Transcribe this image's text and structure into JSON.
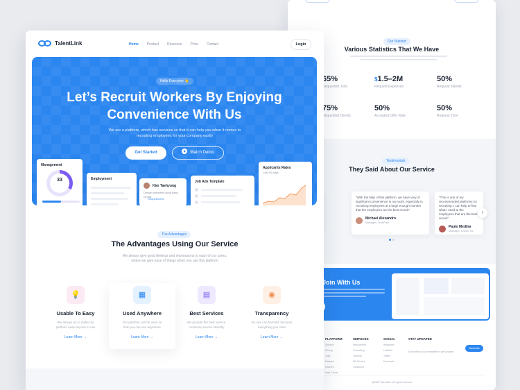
{
  "back": {
    "stats_pill": "Our Statistic",
    "stats_title": "Various Statistics That We Have",
    "stats": [
      {
        "prefix": "",
        "value": "65%",
        "label": "Requested Jobs"
      },
      {
        "prefix": "$",
        "value": "1.5–2M",
        "label": "Request Expenses"
      },
      {
        "prefix": "",
        "value": "50%",
        "label": "Request Talents"
      },
      {
        "prefix": "",
        "value": "75%",
        "label": "Requested Clients"
      },
      {
        "prefix": "",
        "value": "50%",
        "label": "Accepted Offer Rate"
      },
      {
        "prefix": "",
        "value": "50%",
        "label": "Request Time"
      }
    ],
    "testi_pill": "Testimonials",
    "testi_title": "They Said About Our Service",
    "testimonial_main": {
      "quote": "\"With the help of this platform, we have very of significant convenience in our work, especially in recruiting employees at a large enough number that the employees we the best recruit\"",
      "name": "Michael Alexandro",
      "role": "Manager, TechPark"
    },
    "testimonial_right": {
      "quote": "\"This is one of my recommended platforms for recruiting. I can help to find what I need to the employees that are the best recruit\"",
      "name": "Paulo Medina",
      "role": "Manager, Crown Inc"
    },
    "join_title": "Join With Us",
    "footer": [
      {
        "heading": "PLATFORM",
        "items": [
          "Solution",
          "Pricing",
          "Jobs",
          "Partners",
          "Careers",
          "Help Center"
        ]
      },
      {
        "heading": "SERVICES",
        "items": [
          "Recruitment",
          "Consulting",
          "Training",
          "HR Service",
          "Outsource"
        ]
      },
      {
        "heading": "SOCIAL",
        "items": [
          "Instagram",
          "LinkedIn",
          "Twitter",
          "Facebook"
        ]
      },
      {
        "heading": "STAY UPDATED",
        "items": [
          "Subscribe to our newsletter to get updates"
        ]
      }
    ],
    "subscribe_label": "Subscribe",
    "copyright": "@2023 TalentLink. All rights reserved"
  },
  "nav": {
    "brand": "TalentLink",
    "menu": [
      "Home",
      "Product",
      "Resource",
      "Price",
      "Contact"
    ],
    "login": "Login"
  },
  "hero": {
    "pill": "Hello Everyone 👋",
    "title_line1": "Let’s Recruit Workers By Enjoying",
    "title_line2": "Convenience With Us",
    "desc": "We are a platform, which has services so that it can help you when it comes to recruiting employees for your company easily",
    "get_started": "Get Started",
    "watch_demo": "Watch Demo",
    "cards": {
      "management": {
        "title": "Management",
        "value": "33",
        "progress": 0.5
      },
      "employment": {
        "title": "Employment"
      },
      "person": {
        "name": "Kim Taehyung",
        "line": "Design websites using basic format",
        "tag": "Requirement"
      },
      "job_ads": {
        "title": "Job Ads Template"
      },
      "applicants": {
        "title": "Applicants Rates",
        "sub": "Last 30 days"
      }
    }
  },
  "advantages": {
    "pill": "The Advantages",
    "title": "The Advantages Using Our Service",
    "sub_line1": "We always give good feelings and impressions to each of our users,",
    "sub_line2": "where we give ease of things when you use this platform",
    "features": [
      {
        "icon": "lightbulb-icon",
        "glyph": "💡",
        "title": "Usable To Easy",
        "desc_line1": "We always try to make our",
        "desc_line2": "platform ease anyone to use",
        "link": "Learn More  →",
        "bg": "#fbeaf4",
        "fg": "#e46ab3"
      },
      {
        "icon": "building-icon",
        "glyph": "▦",
        "title": "Used Anywhere",
        "desc_line1": "Our platform can be used so",
        "desc_line2": "that you can use anywhere",
        "link": "Learn More  →",
        "bg": "#e4f1ff",
        "fg": "#2b86f0"
      },
      {
        "icon": "presentation-icon",
        "glyph": "▤",
        "title": "Best Services",
        "desc_line1": "We provide the best service,",
        "desc_line2": "customer service standby",
        "link": "Learn More  →",
        "bg": "#efe9ff",
        "fg": "#7b5cf0"
      },
      {
        "icon": "eye-icon",
        "glyph": "◉",
        "title": "Transparency",
        "desc_line1": "No one can harmed, because",
        "desc_line2": "everything you clear",
        "link": "Learn More  →",
        "bg": "#fff0e6",
        "fg": "#f08a4b"
      }
    ]
  }
}
